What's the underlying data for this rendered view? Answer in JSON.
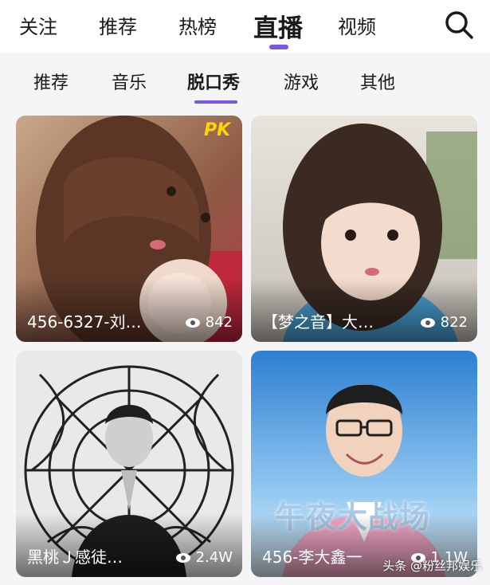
{
  "top_nav": {
    "tabs": [
      "关注",
      "推荐",
      "热榜",
      "直播",
      "视频"
    ],
    "active_tab": "直播",
    "accent": "#7b55e8"
  },
  "sub_nav": {
    "tabs": [
      "推荐",
      "音乐",
      "脱口秀",
      "游戏",
      "其他"
    ],
    "active_tab": "脱口秀"
  },
  "cards": [
    {
      "title": "456-6327-刘…",
      "views": "842",
      "badge": "PK"
    },
    {
      "title": "【梦之音】大…",
      "views": "822"
    },
    {
      "title": "黑桃Ｊ感徒…",
      "views": "2.4W"
    },
    {
      "title": "456-李大鑫一",
      "views": "1.1W",
      "overlay_text": "午夜大战场"
    }
  ],
  "watermark": "头条 @粉丝邦娱乐"
}
